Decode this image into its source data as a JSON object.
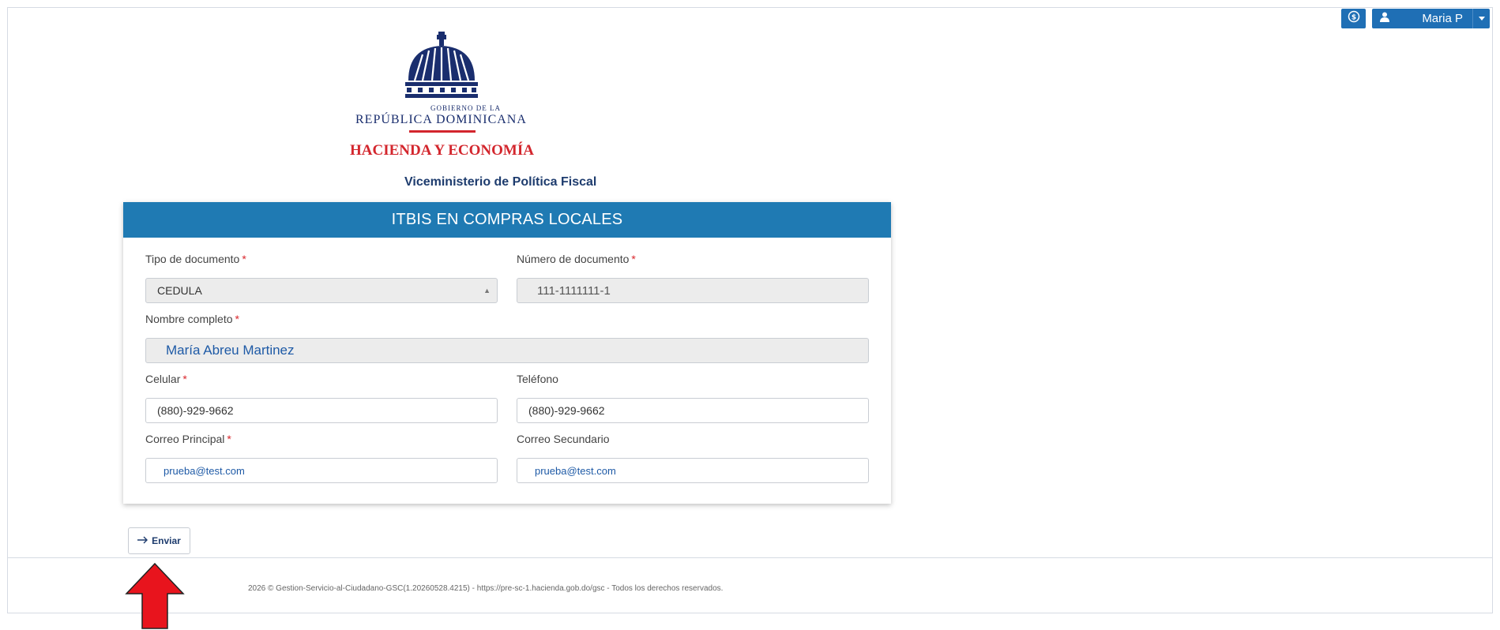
{
  "header": {
    "user_name": "Maria P",
    "dollar_icon": "currency-dollar-icon",
    "user_icon": "user-icon",
    "caret_icon": "caret-down-icon"
  },
  "logo": {
    "gov_small": "GOBIERNO DE LA",
    "gov_big": "REPÚBLICA DOMINICANA",
    "ministry": "HACIENDA Y ECONOMÍA"
  },
  "subtitle": "Viceministerio de Política Fiscal",
  "form": {
    "title": "ITBIS EN COMPRAS LOCALES",
    "required_mark": "*",
    "tipo_documento": {
      "label": "Tipo de documento",
      "value": "CEDULA"
    },
    "numero_documento": {
      "label": "Número de documento",
      "value": "111-1111111-1"
    },
    "nombre_completo": {
      "label": "Nombre completo",
      "value": "María Abreu Martinez"
    },
    "celular": {
      "label": "Celular",
      "value": "(880)-929-9662"
    },
    "telefono": {
      "label": "Teléfono",
      "value": "(880)-929-9662"
    },
    "correo_principal": {
      "label": "Correo Principal",
      "value": "prueba@test.com"
    },
    "correo_secundario": {
      "label": "Correo Secundario",
      "value": "prueba@test.com"
    }
  },
  "actions": {
    "submit_label": "Enviar",
    "submit_icon": "arrow-right-icon"
  },
  "footer": "2026 © Gestion-Servicio-al-Ciudadano-GSC(1.20260528.4215) - https://pre-sc-1.hacienda.gob.do/gsc - Todos los derechos reservados.",
  "colors": {
    "primary": "#1f7ab3",
    "accent_red": "#d3262d",
    "navy": "#1a2e6e"
  }
}
